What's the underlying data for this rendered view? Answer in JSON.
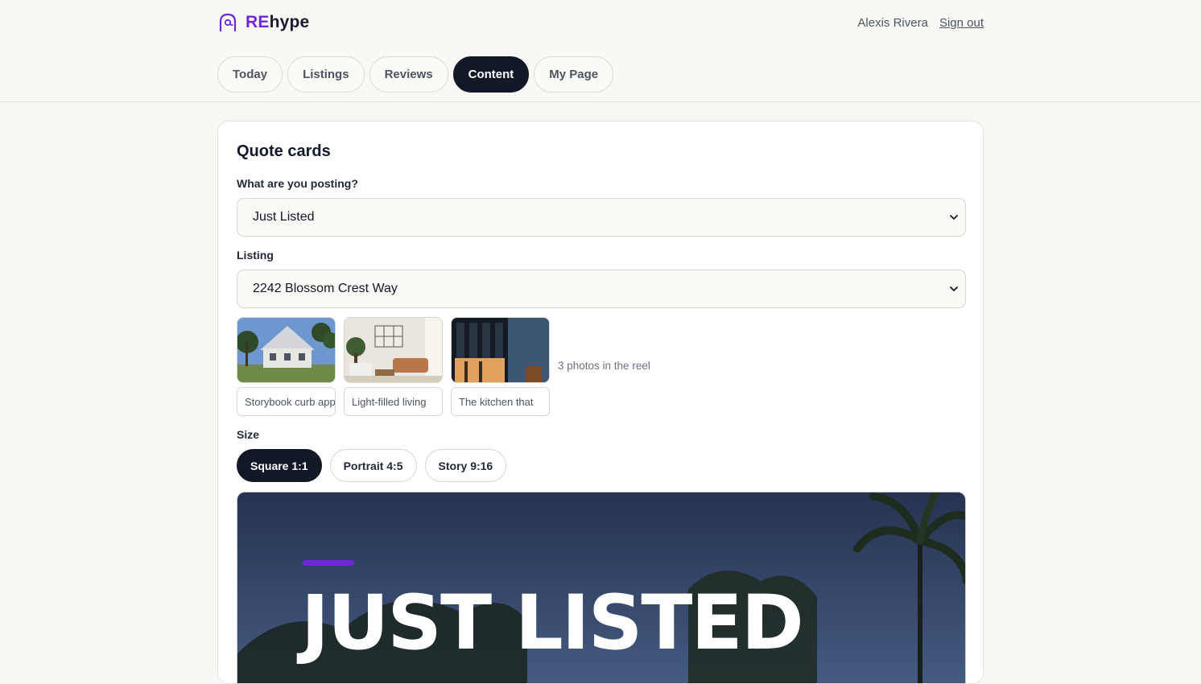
{
  "brand": {
    "prefix": "RE",
    "suffix": "hype"
  },
  "user": {
    "name": "Alexis Rivera",
    "sign_out": "Sign out"
  },
  "tabs": [
    {
      "label": "Today",
      "active": false
    },
    {
      "label": "Listings",
      "active": false
    },
    {
      "label": "Reviews",
      "active": false
    },
    {
      "label": "Content",
      "active": true
    },
    {
      "label": "My Page",
      "active": false
    }
  ],
  "card": {
    "title": "Quote cards",
    "posting_label": "What are you posting?",
    "posting_value": "Just Listed",
    "listing_label": "Listing",
    "listing_value": "2242 Blossom Crest Way",
    "photos": [
      {
        "caption": "Storybook curb appeal",
        "icon": "house-photo"
      },
      {
        "caption": "Light-filled living",
        "icon": "living-room-photo"
      },
      {
        "caption": "The kitchen that",
        "icon": "building-facade-photo"
      }
    ],
    "reel_count": "3 photos in the reel",
    "size_label": "Size",
    "sizes": [
      {
        "label": "Square 1:1",
        "active": true
      },
      {
        "label": "Portrait 4:5",
        "active": false
      },
      {
        "label": "Story 9:16",
        "active": false
      }
    ],
    "preview_headline": "JUST LISTED"
  },
  "colors": {
    "accent": "#6d28d9",
    "dark": "#121826",
    "background": "#f8f7f3"
  }
}
